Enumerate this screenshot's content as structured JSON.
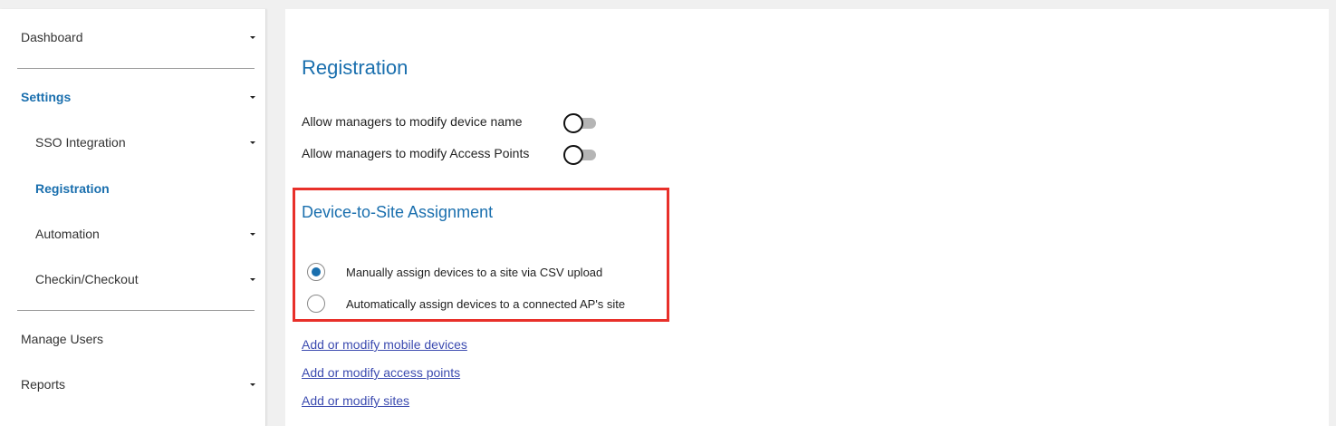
{
  "sidebar": {
    "items": [
      {
        "label": "Dashboard"
      },
      {
        "label": "Settings"
      },
      {
        "label": "SSO Integration"
      },
      {
        "label": "Registration"
      },
      {
        "label": "Automation"
      },
      {
        "label": "Checkin/Checkout"
      },
      {
        "label": "Manage Users"
      },
      {
        "label": "Reports"
      }
    ],
    "icons": {
      "caret": "caret-down-icon"
    }
  },
  "main": {
    "title": "Registration",
    "toggles": [
      {
        "label": "Allow managers to modify device name",
        "state": "off"
      },
      {
        "label": "Allow managers to modify Access Points",
        "state": "off"
      }
    ],
    "assignment": {
      "title": "Device-to-Site Assignment",
      "options": [
        {
          "label": "Manually assign devices to a site via CSV upload",
          "selected": true
        },
        {
          "label": "Automatically assign devices to a connected AP's site",
          "selected": false
        }
      ]
    },
    "links": [
      {
        "label": "Add or modify mobile devices"
      },
      {
        "label": "Add or modify access points"
      },
      {
        "label": "Add or modify sites"
      }
    ]
  },
  "colors": {
    "accent": "#1a6fae",
    "link": "#3c4bb0",
    "highlight": "#e8302a",
    "toggle_track": "#b5b5b5"
  }
}
